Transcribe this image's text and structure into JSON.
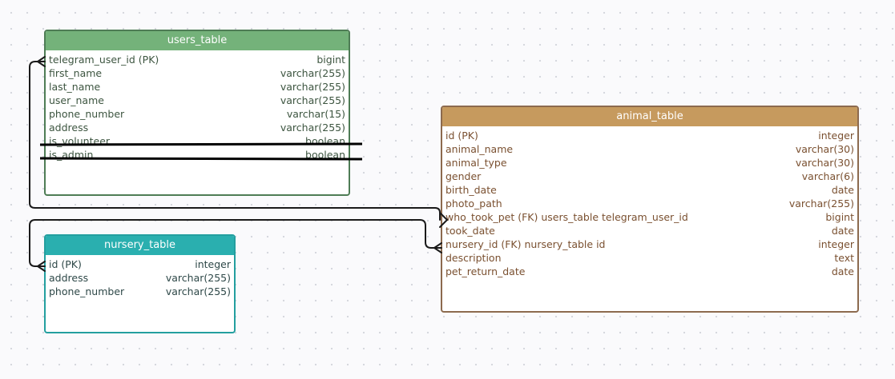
{
  "tables": {
    "users": {
      "title": "users_table",
      "rows": [
        {
          "name": "telegram_user_id (PK)",
          "type": "bigint"
        },
        {
          "name": "first_name",
          "type": "varchar(255)"
        },
        {
          "name": "last_name",
          "type": "varchar(255)"
        },
        {
          "name": "user_name",
          "type": "varchar(255)"
        },
        {
          "name": "phone_number",
          "type": "varchar(15)"
        },
        {
          "name": "address",
          "type": "varchar(255)"
        },
        {
          "name": "is_volunteer",
          "type": "boolean"
        },
        {
          "name": "is_admin",
          "type": "boolean"
        }
      ]
    },
    "nursery": {
      "title": "nursery_table",
      "rows": [
        {
          "name": "id (PK)",
          "type": "integer"
        },
        {
          "name": "address",
          "type": "varchar(255)"
        },
        {
          "name": "phone_number",
          "type": "varchar(255)"
        }
      ]
    },
    "animal": {
      "title": "animal_table",
      "rows": [
        {
          "name": "id (PK)",
          "type": "integer"
        },
        {
          "name": "animal_name",
          "type": "varchar(30)"
        },
        {
          "name": "animal_type",
          "type": "varchar(30)"
        },
        {
          "name": "gender",
          "type": "varchar(6)"
        },
        {
          "name": "birth_date",
          "type": "date"
        },
        {
          "name": "photo_path",
          "type": "varchar(255)"
        },
        {
          "name": "who_took_pet (FK) users_table telegram_user_id",
          "type": "bigint"
        },
        {
          "name": "took_date",
          "type": "date"
        },
        {
          "name": "nursery_id (FK) nursery_table id",
          "type": "integer"
        },
        {
          "name": "description",
          "type": "text"
        },
        {
          "name": "pet_return_date",
          "type": "date"
        }
      ]
    }
  },
  "colors": {
    "users_header": "#74b27a",
    "nursery_header": "#2aafaf",
    "animal_header": "#c69a5e",
    "connector": "#1a1a1a"
  }
}
